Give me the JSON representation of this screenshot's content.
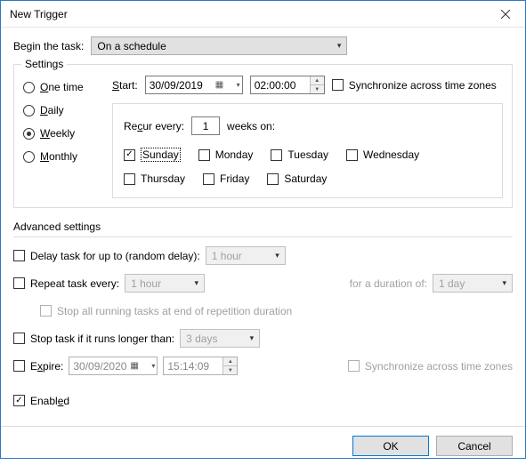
{
  "title": "New Trigger",
  "begin_label": "Begin the task:",
  "begin_value": "On a schedule",
  "settings_legend": "Settings",
  "freq": {
    "one_time": "One time",
    "daily": "Daily",
    "weekly": "Weekly",
    "monthly": "Monthly",
    "selected": "weekly"
  },
  "start_label": "Start:",
  "start_date": "30/09/2019",
  "start_time": "02:00:00",
  "sync_tz": "Synchronize across time zones",
  "recur_label": "Recur every:",
  "recur_value": "1",
  "recur_unit": "weeks on:",
  "days": {
    "sunday": "Sunday",
    "monday": "Monday",
    "tuesday": "Tuesday",
    "wednesday": "Wednesday",
    "thursday": "Thursday",
    "friday": "Friday",
    "saturday": "Saturday"
  },
  "adv_heading": "Advanced settings",
  "adv": {
    "delay_label": "Delay task for up to (random delay):",
    "delay_value": "1 hour",
    "repeat_label": "Repeat task every:",
    "repeat_value": "1 hour",
    "repeat_duration_label": "for a duration of:",
    "repeat_duration_value": "1 day",
    "stop_end_label": "Stop all running tasks at end of repetition duration",
    "stop_longer_label": "Stop task if it runs longer than:",
    "stop_longer_value": "3 days",
    "expire_label": "Expire:",
    "expire_date": "30/09/2020",
    "expire_time": "15:14:09",
    "sync_tz2": "Synchronize across time zones",
    "enabled_label": "Enabled"
  },
  "buttons": {
    "ok": "OK",
    "cancel": "Cancel"
  }
}
